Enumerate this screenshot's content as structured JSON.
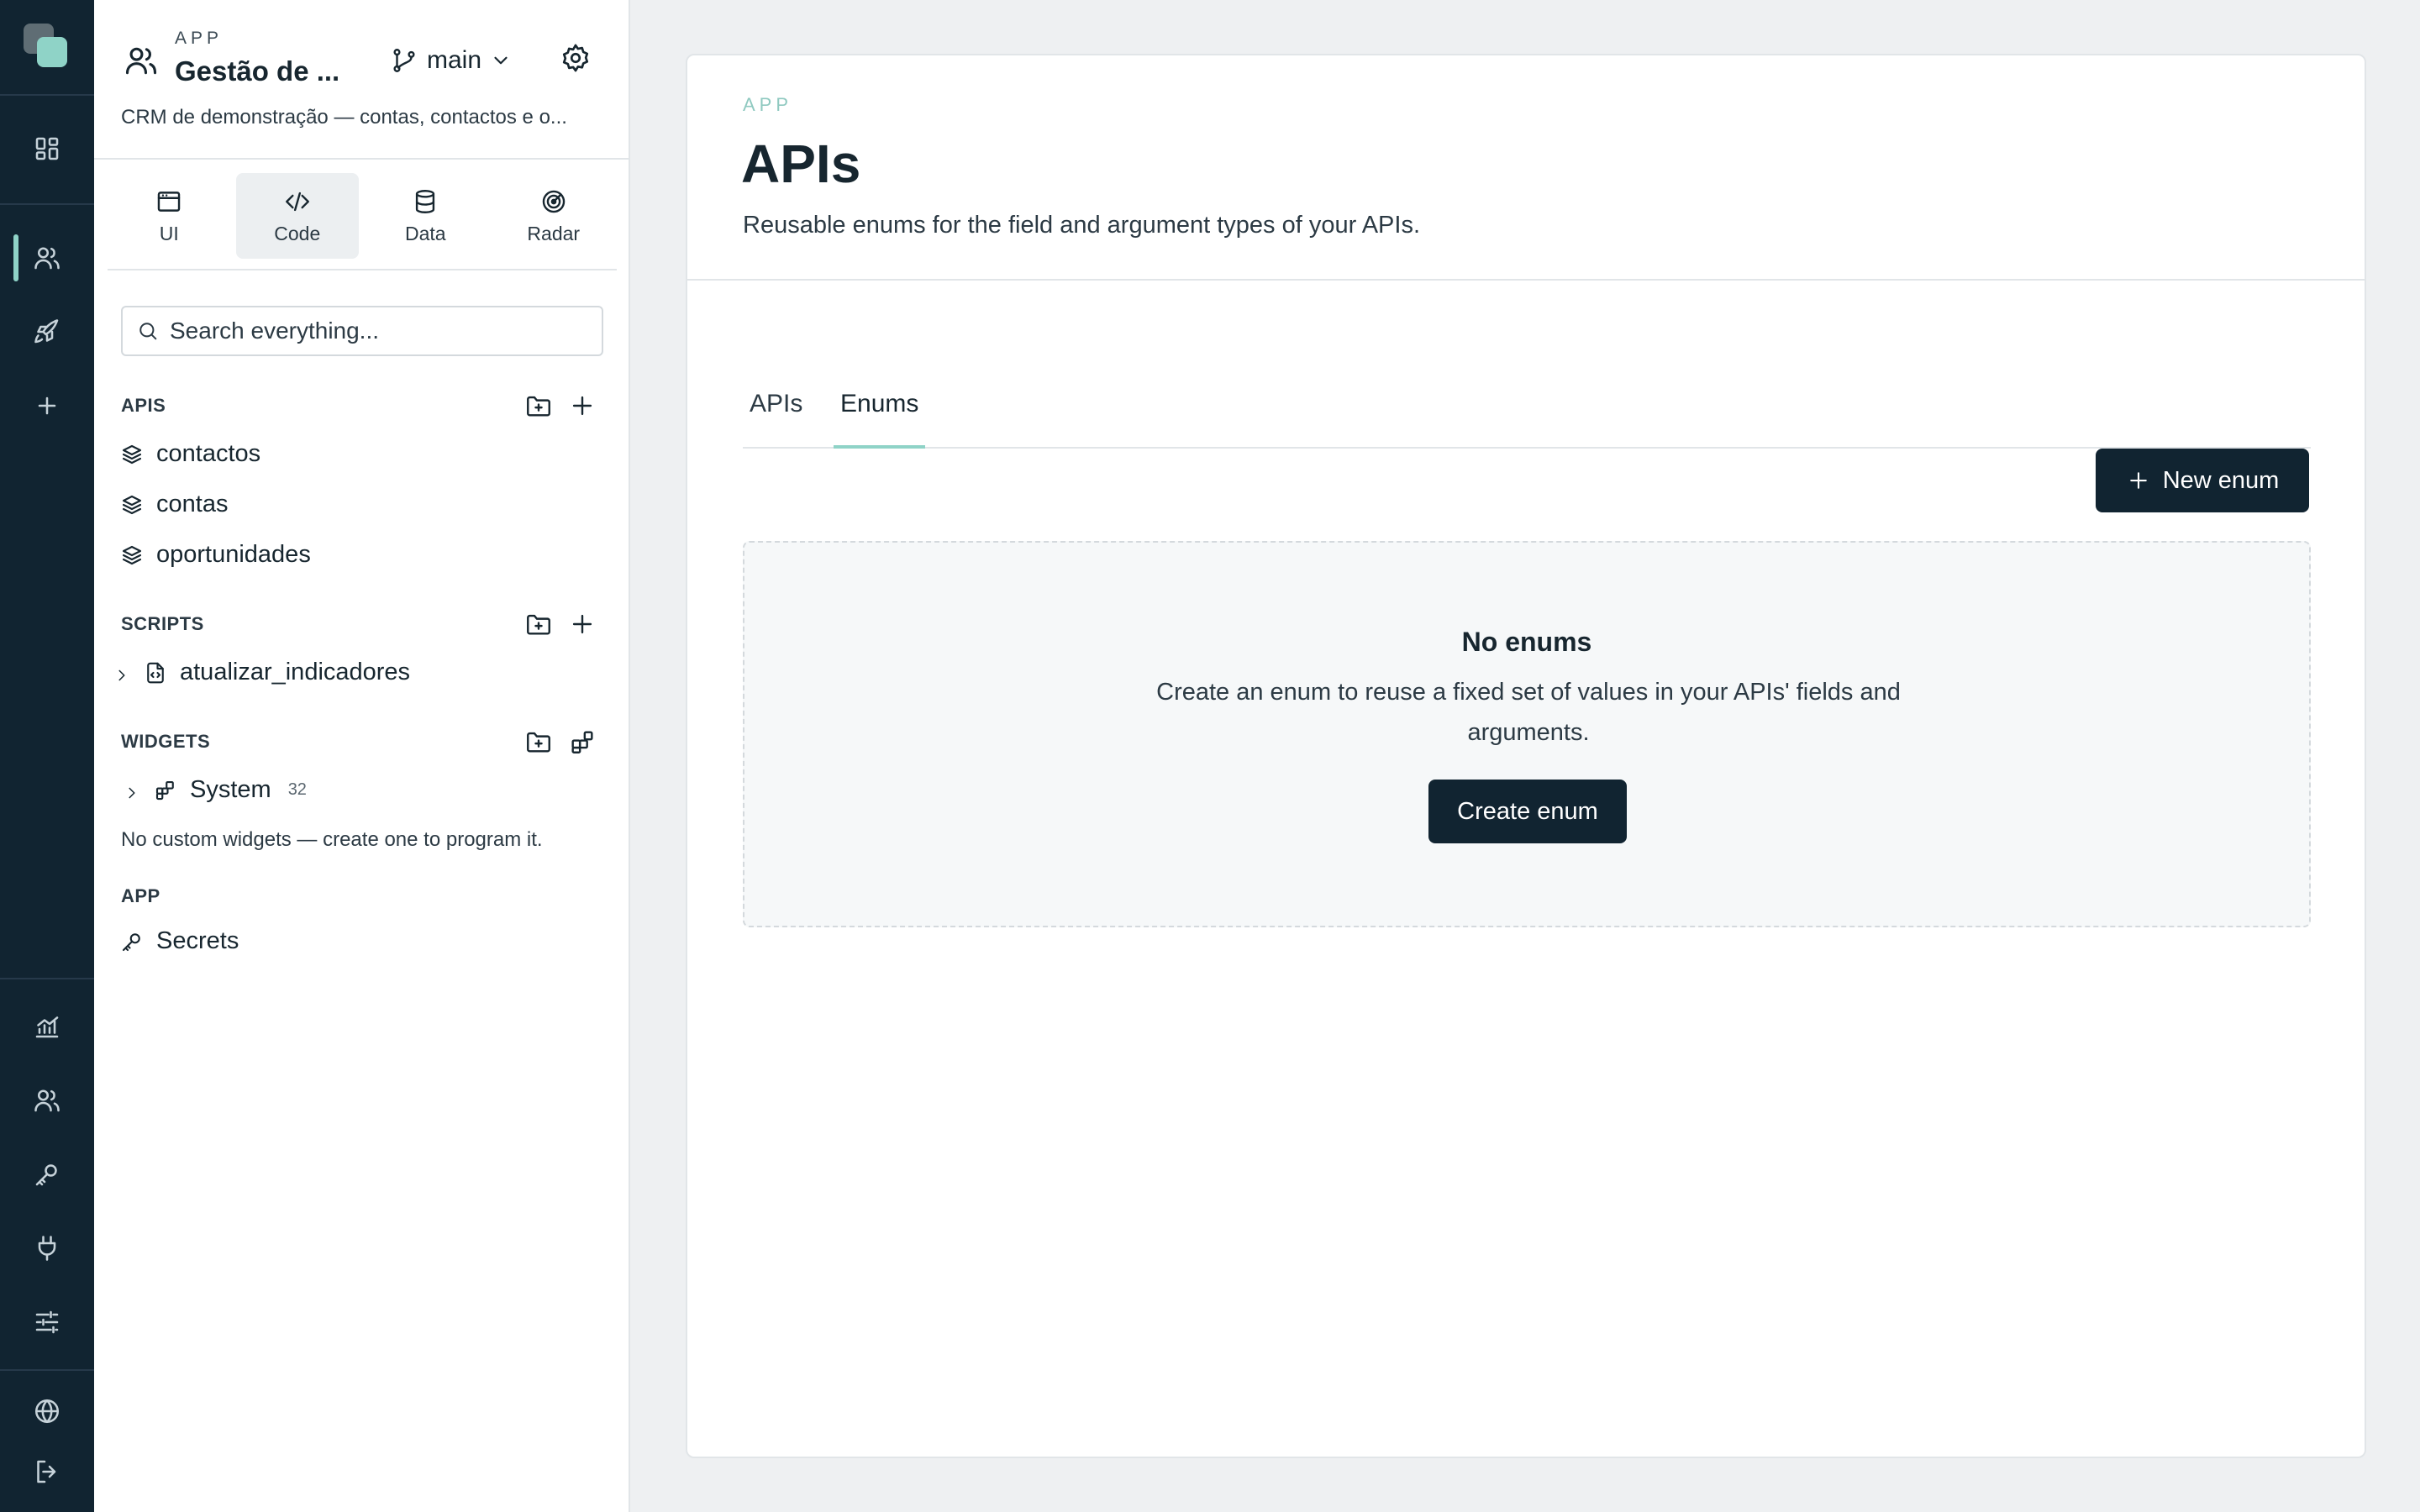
{
  "rail": {
    "icons": [
      "dashboard-icon",
      "users-icon",
      "rocket-icon",
      "plus-icon",
      "analytics-icon",
      "team-icon",
      "key-icon",
      "plug-icon",
      "sliders-icon",
      "globe-icon",
      "logout-icon"
    ],
    "accent": "#8fd3c7",
    "background": "#112431"
  },
  "app_header": {
    "kicker": "APP",
    "title": "Gestão de ...",
    "branch": "main",
    "description": "CRM de demonstração — contas, contactos e o..."
  },
  "mode_tabs": [
    {
      "label": "UI",
      "icon": "window-icon"
    },
    {
      "label": "Code",
      "icon": "code-icon",
      "active": true
    },
    {
      "label": "Data",
      "icon": "database-icon"
    },
    {
      "label": "Radar",
      "icon": "radar-icon"
    }
  ],
  "search": {
    "placeholder": "Search everything..."
  },
  "sections": {
    "apis": {
      "heading": "APIS",
      "items": [
        "contactos",
        "contas",
        "oportunidades"
      ]
    },
    "scripts": {
      "heading": "SCRIPTS",
      "items": [
        "atualizar_indicadores"
      ]
    },
    "widgets": {
      "heading": "WIDGETS",
      "items": [
        {
          "label": "System",
          "count": "32"
        }
      ],
      "note": "No custom widgets — create one to program it."
    },
    "app": {
      "heading": "APP",
      "items": [
        "Secrets"
      ]
    }
  },
  "main": {
    "kicker": "APP",
    "title": "APIs",
    "subtitle": "Reusable enums for the field and argument types of your APIs.",
    "tabs": [
      {
        "label": "APIs",
        "active": false
      },
      {
        "label": "Enums",
        "active": true
      }
    ],
    "new_button": "New enum",
    "empty": {
      "title": "No enums",
      "description": "Create an enum to reuse a fixed set of values in your APIs' fields and arguments.",
      "button": "Create enum"
    }
  }
}
